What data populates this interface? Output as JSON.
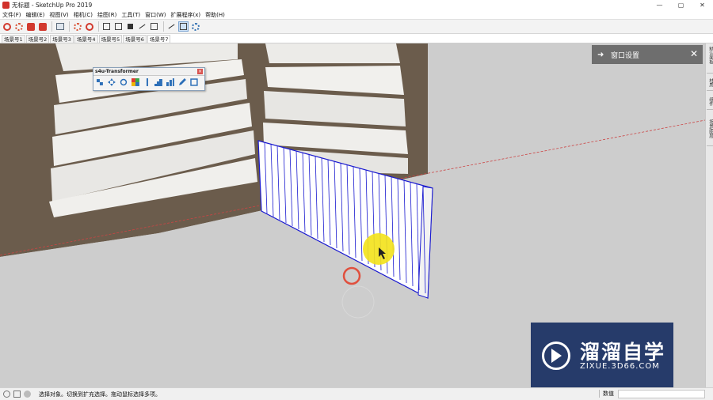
{
  "window": {
    "title": "无标题 - SketchUp Pro 2019",
    "controls": [
      "—",
      "▢",
      "✕"
    ]
  },
  "menu": [
    "文件(F)",
    "编辑(E)",
    "视图(V)",
    "相机(C)",
    "绘图(R)",
    "工具(T)",
    "窗口(W)",
    "扩展程序(x)",
    "帮助(H)"
  ],
  "toolbar": {
    "icons": [
      "sketchup-logo-icon",
      "gear-icon",
      "open-folder-icon",
      "save-icon",
      "print-icon",
      "settings-icon",
      "component-icon",
      "view-front-icon",
      "view-iso-icon",
      "view-shaded-icon",
      "line-icon",
      "rectangle-icon",
      "orbit-icon",
      "layers-icon"
    ]
  },
  "scenes": {
    "tabs": [
      "场景号1",
      "场景号2",
      "场景号3",
      "场景号4",
      "场景号5",
      "场景号6",
      "场景号7"
    ],
    "active_index": 6
  },
  "floating_toolbar": {
    "title": "s4u-Transformer",
    "close": "×"
  },
  "right_dock": {
    "tabs": [
      "默认面板",
      "材质",
      "组件",
      "场景/图层"
    ]
  },
  "panel": {
    "arrow": "➜",
    "title": "窗口设置",
    "close": "✕"
  },
  "watermark": {
    "title": "溜溜自学",
    "url": "ZIXUE.3D66.COM"
  },
  "status": {
    "text": "选择对象。切换到扩充选择。拖动鼠标选择多项。",
    "measure_label": "数值",
    "measure_value": ""
  },
  "colors": {
    "viewport_bg": "#cdcdcd",
    "selection_blue": "#1a1ad0",
    "panel_bg": "#6e6e6e",
    "watermark_bg": "#263b6a",
    "cursor_highlight": "#f3e21a",
    "click_ring": "#e0503e"
  }
}
